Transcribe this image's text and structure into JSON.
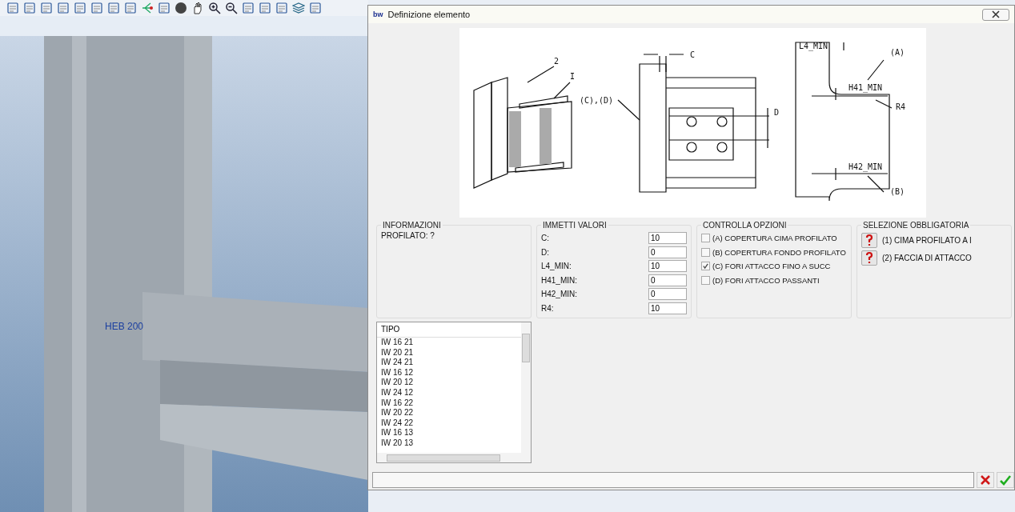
{
  "viewport": {
    "label": "HEB 200"
  },
  "dialog": {
    "logo": "bw",
    "title": "Definizione elemento",
    "diagram": {
      "labels": [
        "2",
        "I",
        "C",
        "(C),(D)",
        "D",
        "L4_MIN",
        "(A)",
        "H41_MIN",
        "R4",
        "H42_MIN",
        "(B)"
      ]
    },
    "info": {
      "heading": "INFORMAZIONI",
      "text": "PROFILATO: ?"
    },
    "values": {
      "heading": "IMMETTI VALORI",
      "fields": [
        {
          "label": "C:",
          "value": "10"
        },
        {
          "label": "D:",
          "value": "0"
        },
        {
          "label": "L4_MIN:",
          "value": "10"
        },
        {
          "label": "H41_MIN:",
          "value": "0"
        },
        {
          "label": "H42_MIN:",
          "value": "0"
        },
        {
          "label": "R4:",
          "value": "10"
        }
      ]
    },
    "options": {
      "heading": "CONTROLLA OPZIONI",
      "items": [
        {
          "label": "(A) COPERTURA CIMA PROFILATO",
          "checked": false
        },
        {
          "label": "(B) COPERTURA FONDO PROFILATO",
          "checked": false
        },
        {
          "label": "(C) FORI ATTACCO FINO A SUCC",
          "checked": true
        },
        {
          "label": "(D) FORI ATTACCO PASSANTI",
          "checked": false
        }
      ]
    },
    "selection": {
      "heading": "SELEZIONE OBBLIGATORIA",
      "items": [
        {
          "label": "(1) CIMA PROFILATO A I"
        },
        {
          "label": "(2) FACCIA DI ATTACCO"
        }
      ]
    },
    "list": {
      "heading": "TIPO",
      "rows": [
        "IW 16 21",
        "IW 20 21",
        "IW 24 21",
        "IW 16 12",
        "IW 20 12",
        "IW 24 12",
        "IW 16 22",
        "IW 20 22",
        "IW 24 22",
        "IW 16 13",
        "IW 20 13"
      ]
    }
  }
}
